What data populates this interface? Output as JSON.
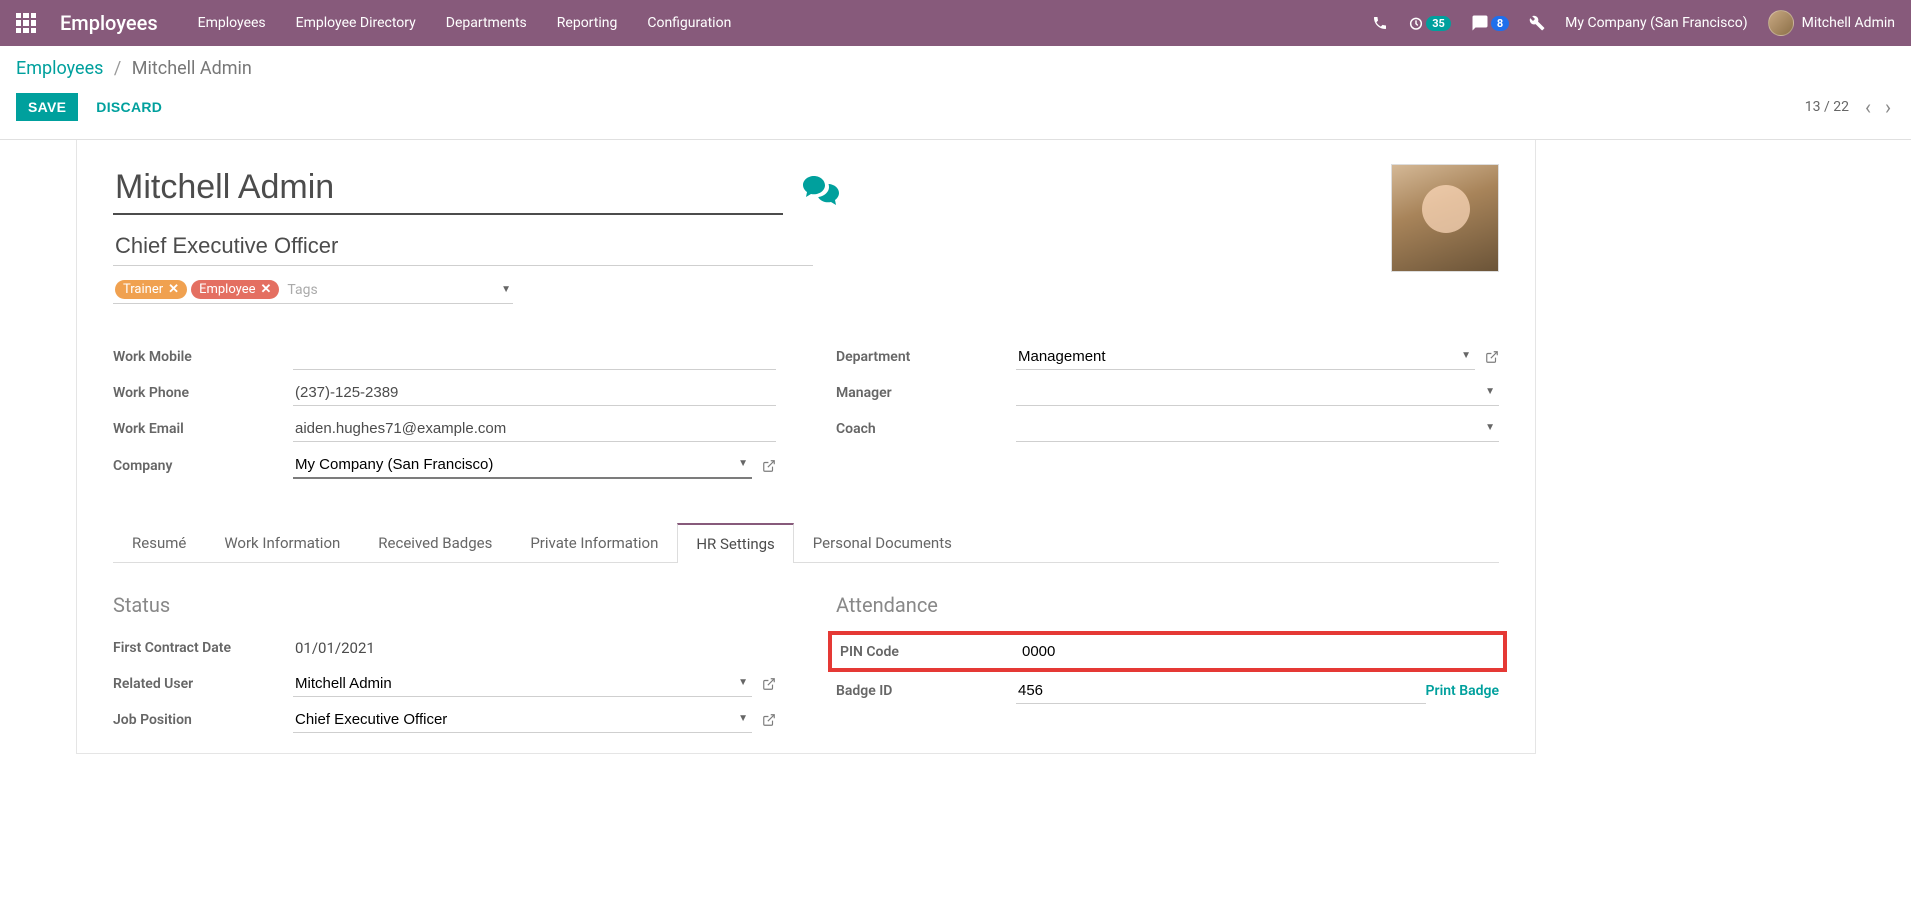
{
  "nav": {
    "brand": "Employees",
    "menu": [
      "Employees",
      "Employee Directory",
      "Departments",
      "Reporting",
      "Configuration"
    ],
    "clock_badge": "35",
    "chat_badge": "8",
    "company": "My Company (San Francisco)",
    "user": "Mitchell Admin"
  },
  "breadcrumb": {
    "root": "Employees",
    "current": "Mitchell Admin"
  },
  "buttons": {
    "save": "SAVE",
    "discard": "DISCARD"
  },
  "pager": {
    "text": "13 / 22"
  },
  "form": {
    "name": "Mitchell Admin",
    "title": "Chief Executive Officer",
    "tags": [
      {
        "label": "Trainer",
        "color": "tag-orange"
      },
      {
        "label": "Employee",
        "color": "tag-red"
      }
    ],
    "tags_placeholder": "Tags",
    "fields_left": {
      "work_mobile": {
        "label": "Work Mobile",
        "value": ""
      },
      "work_phone": {
        "label": "Work Phone",
        "value": "(237)-125-2389"
      },
      "work_email": {
        "label": "Work Email",
        "value": "aiden.hughes71@example.com"
      },
      "company": {
        "label": "Company",
        "value": "My Company (San Francisco)"
      }
    },
    "fields_right": {
      "department": {
        "label": "Department",
        "value": "Management"
      },
      "manager": {
        "label": "Manager",
        "value": ""
      },
      "coach": {
        "label": "Coach",
        "value": ""
      }
    }
  },
  "tabs": [
    "Resumé",
    "Work Information",
    "Received Badges",
    "Private Information",
    "HR Settings",
    "Personal Documents"
  ],
  "active_tab": 4,
  "hr_settings": {
    "status": {
      "title": "Status",
      "first_contract": {
        "label": "First Contract Date",
        "value": "01/01/2021"
      },
      "related_user": {
        "label": "Related User",
        "value": "Mitchell Admin"
      },
      "job_position": {
        "label": "Job Position",
        "value": "Chief Executive Officer"
      }
    },
    "attendance": {
      "title": "Attendance",
      "pin": {
        "label": "PIN Code",
        "value": "0000"
      },
      "badge_id": {
        "label": "Badge ID",
        "value": "456"
      },
      "print": "Print Badge"
    }
  }
}
